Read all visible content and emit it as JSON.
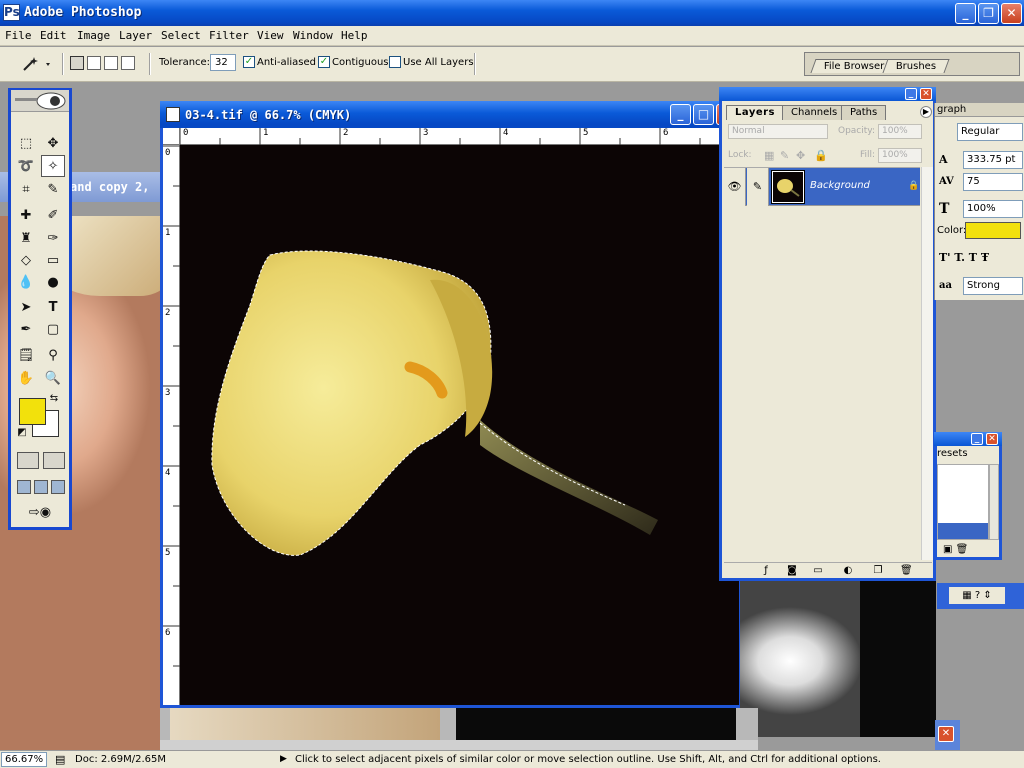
{
  "app": {
    "title": "Adobe Photoshop",
    "icon_name": "photoshop-icon"
  },
  "menu": [
    "File",
    "Edit",
    "Image",
    "Layer",
    "Select",
    "Filter",
    "View",
    "Window",
    "Help"
  ],
  "options": {
    "tolerance_label": "Tolerance:",
    "tolerance_value": "32",
    "anti_aliased_label": "Anti-aliased",
    "anti_aliased_checked": true,
    "contiguous_label": "Contiguous",
    "contiguous_checked": true,
    "use_all_layers_label": "Use All Layers",
    "use_all_layers_checked": false,
    "file_browser_tab": "File Browser",
    "brushes_tab": "Brushes"
  },
  "colors": {
    "foreground": "#f2e10c",
    "background": "#ffffff",
    "xp_blue": "#1e55d6",
    "layer_selected": "#3a66c4"
  },
  "background_doc": {
    "title_fragment": "and copy 2,"
  },
  "document": {
    "title": "03-4.tif @ 66.7% (CMYK)",
    "ruler_top": [
      "0",
      "1",
      "2",
      "3",
      "4",
      "5",
      "6"
    ],
    "ruler_left": [
      "0",
      "1",
      "2",
      "3",
      "4",
      "5",
      "6"
    ]
  },
  "layers_palette": {
    "tabs": [
      "Layers",
      "Channels",
      "Paths"
    ],
    "blend_mode": "Normal",
    "opacity_label": "Opacity:",
    "opacity_value": "100%",
    "lock_label": "Lock:",
    "fill_label": "Fill:",
    "fill_value": "100%",
    "layers": [
      {
        "name": "Background",
        "visible": true,
        "locked": true
      }
    ]
  },
  "character_palette": {
    "tab": "graph",
    "font_style": "Regular",
    "leading": "333.75 pt",
    "tracking": "75",
    "vertical_scale": "100%",
    "color_label": "Color:",
    "color_value": "#f2e10c",
    "antialias": "Strong"
  },
  "preset_palette": {
    "tab": "resets"
  },
  "status": {
    "zoom": "66.67%",
    "doc_info": "Doc: 2.69M/2.65M",
    "hint": "Click to select adjacent pixels of similar color or move selection outline.  Use Shift, Alt, and Ctrl for additional options."
  }
}
